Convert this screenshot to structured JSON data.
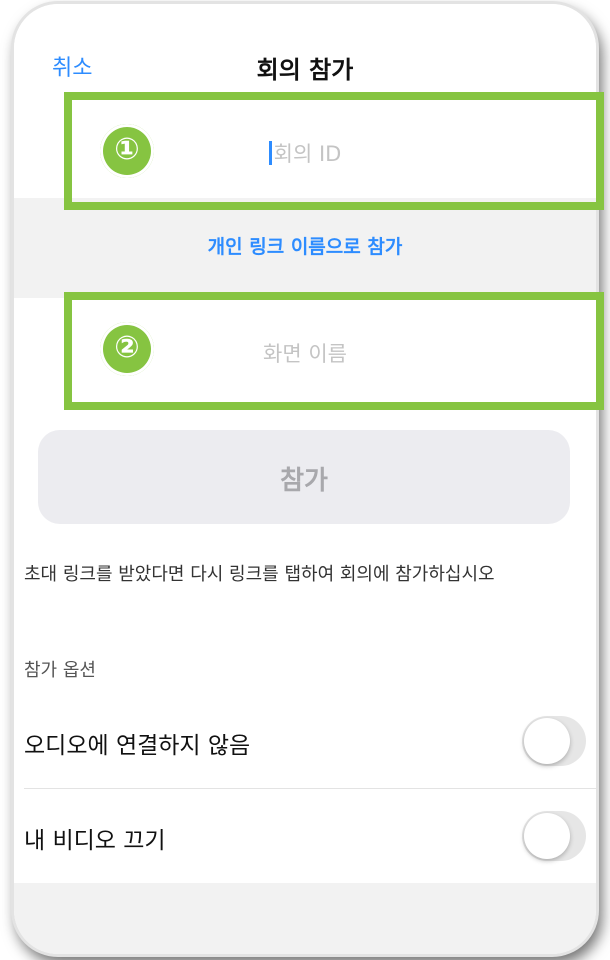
{
  "nav": {
    "cancel_label": "취소",
    "title": "회의 참가"
  },
  "meeting_id": {
    "placeholder": "회의 ID"
  },
  "personal_link_label": "개인 링크 이름으로 참가",
  "screen_name": {
    "placeholder": "화면 이름"
  },
  "join_button_label": "참가",
  "hint_text": "초대 링크를 받았다면 다시 링크를 탭하여 회의에 참가하십시오",
  "options": {
    "section_label": "참가 옵션",
    "items": [
      {
        "label": "오디오에 연결하지 않음",
        "enabled": false
      },
      {
        "label": "내 비디오 끄기",
        "enabled": false
      }
    ]
  },
  "annotations": [
    {
      "number": "①",
      "target": "meeting-id-field"
    },
    {
      "number": "②",
      "target": "screen-name-field"
    }
  ],
  "colors": {
    "accent_blue": "#2d8cff",
    "highlight_green": "#86c441",
    "section_gray": "#f2f2f2",
    "button_gray": "#ececf0"
  }
}
